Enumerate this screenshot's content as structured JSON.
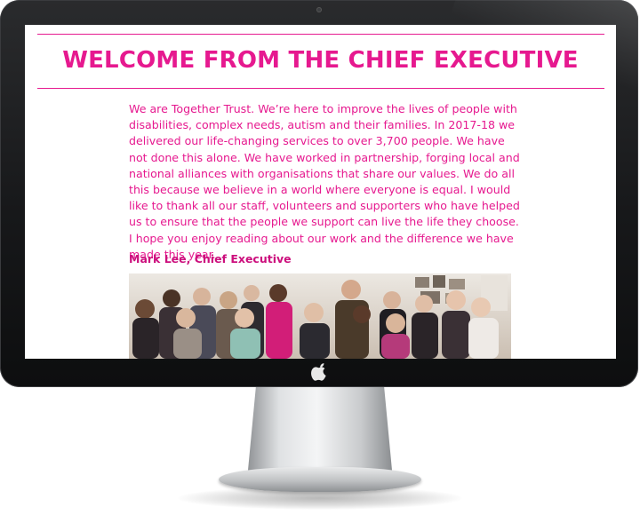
{
  "page": {
    "title": "WELCOME FROM THE CHIEF EXECUTIVE",
    "intro": "We are Together Trust. We’re here to improve the lives of people with disabilities, complex needs, autism and their families. In 2017-18 we delivered our life-changing services to over 3,700 people. We have not done this alone. We have worked in partnership, forging local and national alliances with organisations that share our values. We do all this because we believe in a world where everyone is equal. I would like to thank all our staff, volunteers and supporters who have helped us to ensure that the people we support can live the life they choose. I hope you enjoy reading about our work and the difference we have made this year.",
    "signature": "Mark Lee, Chief Executive"
  },
  "colors": {
    "accent": "#e6198f",
    "accent_dark": "#cc0f7d",
    "bezel": "#17181a"
  },
  "icons": [
    "camera-icon",
    "apple-logo-icon"
  ]
}
